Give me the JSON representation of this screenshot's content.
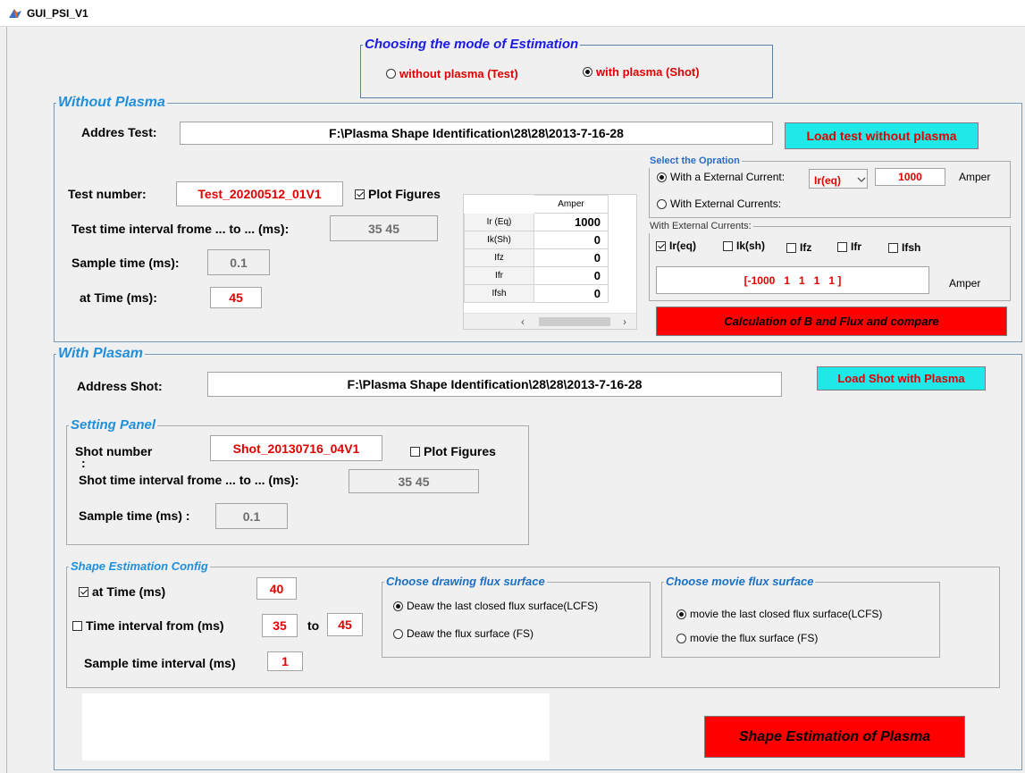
{
  "window": {
    "title": "GUI_PSI_V1"
  },
  "mode_panel": {
    "title": "Choosing the mode of Estimation",
    "options": [
      {
        "label": "without plasma (Test)",
        "selected": false
      },
      {
        "label": "with plasma (Shot)",
        "selected": true
      }
    ]
  },
  "without_plasma": {
    "title": "Without Plasma",
    "address_label": "Addres Test:",
    "address_value": "F:\\Plasma Shape Identification\\28\\28\\2013-7-16-28",
    "load_button": "Load test without plasma",
    "test_number_label": "Test number:",
    "test_number_value": "Test_20200512_01V1",
    "plot_figures_label": "Plot Figures",
    "plot_figures_checked": true,
    "interval_label": "Test time  interval frome ... to ... (ms):",
    "interval_value": "35  45",
    "sample_label": "Sample time (ms):",
    "sample_value": "0.1",
    "at_time_label": "at Time (ms):",
    "at_time_value": "45",
    "table": {
      "column": "Amper",
      "rows": [
        {
          "name": "Ir (Eq)",
          "value": "1000"
        },
        {
          "name": "Ik(Sh)",
          "value": "0"
        },
        {
          "name": "Ifz",
          "value": "0"
        },
        {
          "name": "Ifr",
          "value": "0"
        },
        {
          "name": "Ifsh",
          "value": "0"
        }
      ]
    },
    "operation": {
      "title": "Select  the Opration",
      "option1_label": "With a External Current:",
      "option1_selected": true,
      "current_select": "Ir(eq)",
      "current_value": "1000",
      "unit": "Amper",
      "option2_label": "With  External Currents:",
      "option2_selected": false
    },
    "currents": {
      "title": "With External Currents:",
      "checks": [
        {
          "label": "Ir(eq)",
          "checked": true
        },
        {
          "label": "Ik(sh)",
          "checked": false
        },
        {
          "label": "Ifz",
          "checked": false
        },
        {
          "label": "Ifr",
          "checked": false
        },
        {
          "label": "Ifsh",
          "checked": false
        }
      ],
      "vector_value": "[-1000   1   1   1   1 ]",
      "unit": "Amper"
    },
    "calc_button": "Calculation of B and Flux and compare"
  },
  "with_plasma": {
    "title": "With Plasam",
    "address_label": "Address Shot:",
    "address_value": "F:\\Plasma Shape Identification\\28\\28\\2013-7-16-28",
    "load_button": "Load Shot with Plasma",
    "setting": {
      "title": "Setting Panel",
      "shot_number_label": "Shot number",
      "shot_number_colon": ":",
      "shot_number_value": "Shot_20130716_04V1",
      "plot_figures_label": "Plot Figures",
      "plot_figures_checked": false,
      "interval_label": "Shot time  interval frome ... to ... (ms):",
      "interval_value": "35 45",
      "sample_label": "Sample time (ms) :",
      "sample_value": "0.1"
    },
    "config": {
      "title": "Shape Estimation Config",
      "at_time_label": "at Time (ms)",
      "at_time_checked": true,
      "at_time_value": "40",
      "interval_label": "Time interval from (ms)",
      "interval_checked": false,
      "interval_from": "35",
      "to_label": "to",
      "interval_to": "45",
      "sample_label": "Sample time interval (ms)",
      "sample_value": "1",
      "drawing": {
        "title": "Choose drawing flux surface",
        "option1": "Deaw the last closed flux surface(LCFS)",
        "option1_selected": true,
        "option2": "Deaw the  flux surface (FS)",
        "option2_selected": false
      },
      "movie": {
        "title": "Choose movie flux surface",
        "option1": "movie the last closed flux surface(LCFS)",
        "option1_selected": true,
        "option2": "movie the  flux surface (FS)",
        "option2_selected": false
      }
    },
    "estimate_button": "Shape Estimation of Plasma"
  },
  "colors": {
    "accent_text": "#1f8fdc",
    "mode_title": "#1a1ae6",
    "value_red": "#e00000",
    "button_cyan": "#1ee8e8",
    "button_red": "#ff0000"
  }
}
